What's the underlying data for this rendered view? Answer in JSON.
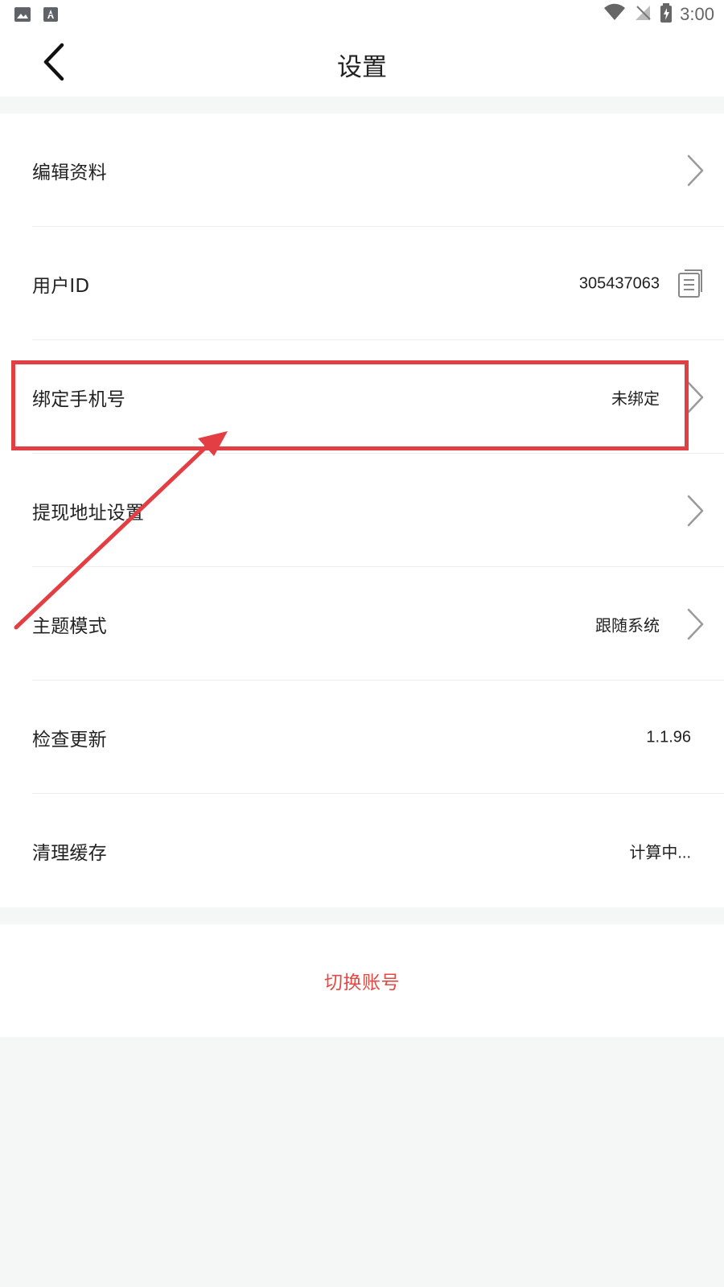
{
  "status_bar": {
    "time": "3:00",
    "left_icons": [
      "image-icon",
      "keyboard-icon"
    ],
    "right_icons": [
      "wifi-icon",
      "signal-off-icon",
      "battery-charging-icon"
    ]
  },
  "nav": {
    "title": "设置",
    "back_icon": "back-chevron-icon"
  },
  "settings": [
    {
      "label": "编辑资料",
      "value": "",
      "trailing": "chevron-right-icon"
    },
    {
      "label": "用户ID",
      "value": "305437063",
      "trailing": "copy-icon"
    },
    {
      "label": "绑定手机号",
      "value": "未绑定",
      "trailing": "chevron-right-icon"
    },
    {
      "label": "提现地址设置",
      "value": "",
      "trailing": "chevron-right-icon"
    },
    {
      "label": "主题模式",
      "value": "跟随系统",
      "trailing": "chevron-right-icon"
    },
    {
      "label": "检查更新",
      "value": "1.1.96",
      "trailing": ""
    },
    {
      "label": "清理缓存",
      "value": "计算中...",
      "trailing": ""
    }
  ],
  "switch_account": {
    "label": "切换账号"
  },
  "annotation": {
    "highlight_color": "#e33e43",
    "highlighted_item": "绑定手机号"
  },
  "colors": {
    "background": "#f5f6f6",
    "surface": "#ffffff",
    "primary_text": "#222222",
    "secondary_text": "#222222",
    "switch_account": "#e34a45",
    "chevron": "#9a9a9a"
  }
}
